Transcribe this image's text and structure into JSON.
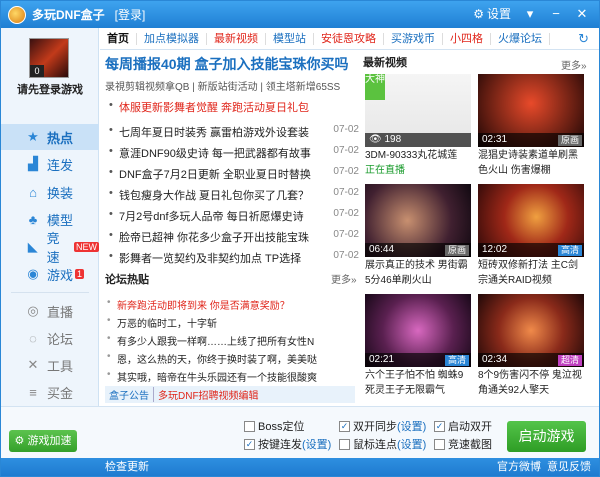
{
  "titlebar": {
    "title": "多玩DNF盒子",
    "login": "[登录]",
    "settings": "设置"
  },
  "sidebar": {
    "login_text": "请先登录游戏",
    "avatar_badge": "0",
    "items": [
      {
        "label": "热点"
      },
      {
        "label": "连发"
      },
      {
        "label": "换装"
      },
      {
        "label": "模型"
      },
      {
        "label": "竞速",
        "badge": "NEW"
      },
      {
        "label": "游戏",
        "badge": "1"
      }
    ],
    "grey_items": [
      {
        "label": "直播"
      },
      {
        "label": "论坛"
      },
      {
        "label": "工具"
      },
      {
        "label": "买金"
      }
    ]
  },
  "tabs": [
    "首页",
    "加点模拟器",
    "最新视频",
    "模型站",
    "安徒恩攻略",
    "买游戏币",
    "小四格",
    "火爆论坛"
  ],
  "news": {
    "headline": "每周播报40期 盒子加入技能宝珠你买吗",
    "subheads": "录視剪辑视频拿QB  |  新版站街活动  |  领主塔新增65SS",
    "items": [
      {
        "title": "体服更新影舞者觉醒 奔跑活动夏日礼包",
        "date": "",
        "red": true
      },
      {
        "title": "七周年夏日时装秀 赢雷柏游戏外设套装",
        "date": "07-02"
      },
      {
        "title": "意涯DNF90级史诗 每一把武器都有故事",
        "date": "07-02"
      },
      {
        "title": "DNF盒子7月2日更新 全职业夏日时替换",
        "date": "07-02"
      },
      {
        "title": "钱包瘦身大作战 夏日礼包你买了几套？",
        "date": "07-02"
      },
      {
        "title": "7月2号dnf多玩人品帝 每日祈愿爆史诗",
        "date": "07-02"
      },
      {
        "title": "脸帝已超神 你花多少盒子开出技能宝珠",
        "date": "07-02"
      },
      {
        "title": "影舞者一览契约及非契约加点 TP选择",
        "date": "07-02"
      }
    ]
  },
  "forum": {
    "title": "论坛热贴",
    "more": "更多»",
    "items": [
      {
        "title": "新奔跑活动即将到来 你是否满意奖励？",
        "red": true
      },
      {
        "title": "万恶的临时工，十字斩"
      },
      {
        "title": "有多少人跟我一样啊……上线了把所有女性N"
      },
      {
        "title": "恩，这么热的天，你终于换时装了啊，美美哒"
      },
      {
        "title": "其实哦，暗帝在牛头乐园还有一个技能很酸爽"
      }
    ]
  },
  "announce": {
    "label": "盒子公告",
    "text": "多玩DNF招聘视频编辑"
  },
  "videos": {
    "title": "最新视频",
    "more": "更多»",
    "items": [
      {
        "bar": "198",
        "caption": "3DM-90333丸花城莲",
        "caption2": "正在直播",
        "tag": "大神"
      },
      {
        "bar": "02:31",
        "caption": "混猖史诗装素道单刷黑",
        "caption2": "色火山 伤害爆棚",
        "tag": "原画"
      },
      {
        "bar": "06:44",
        "caption": "展示真正的技术 男街霸",
        "caption2": "5分46单刷火山",
        "tag": "原画"
      },
      {
        "bar": "12:02",
        "caption": "短砖双修新打法 主C剑",
        "caption2": "宗通关RAID视频",
        "tag": "高清"
      },
      {
        "bar": "02:21",
        "caption": "六个王子怕不怕 蜘蛛9",
        "caption2": "死灵王子无限霸气",
        "tag": "高清"
      },
      {
        "bar": "02:34",
        "caption": "8个9伤害闪不停 鬼泣视",
        "caption2": "角通关92人擎天",
        "tag": "超清"
      }
    ]
  },
  "options": {
    "boss": "Boss定位",
    "hotkey": "按键连发",
    "hotkey_link": "(设置)",
    "dual": "双开同步",
    "dual_link": "(设置)",
    "mouse": "鼠标连点",
    "mouse_link": "(设置)",
    "autoopen": "启动双开",
    "screenshot": "竞速截图",
    "accel": "游戏加速",
    "start": "启动游戏"
  },
  "status": {
    "check": "检查更新",
    "weibo": "官方微博",
    "feedback": "意见反馈"
  }
}
